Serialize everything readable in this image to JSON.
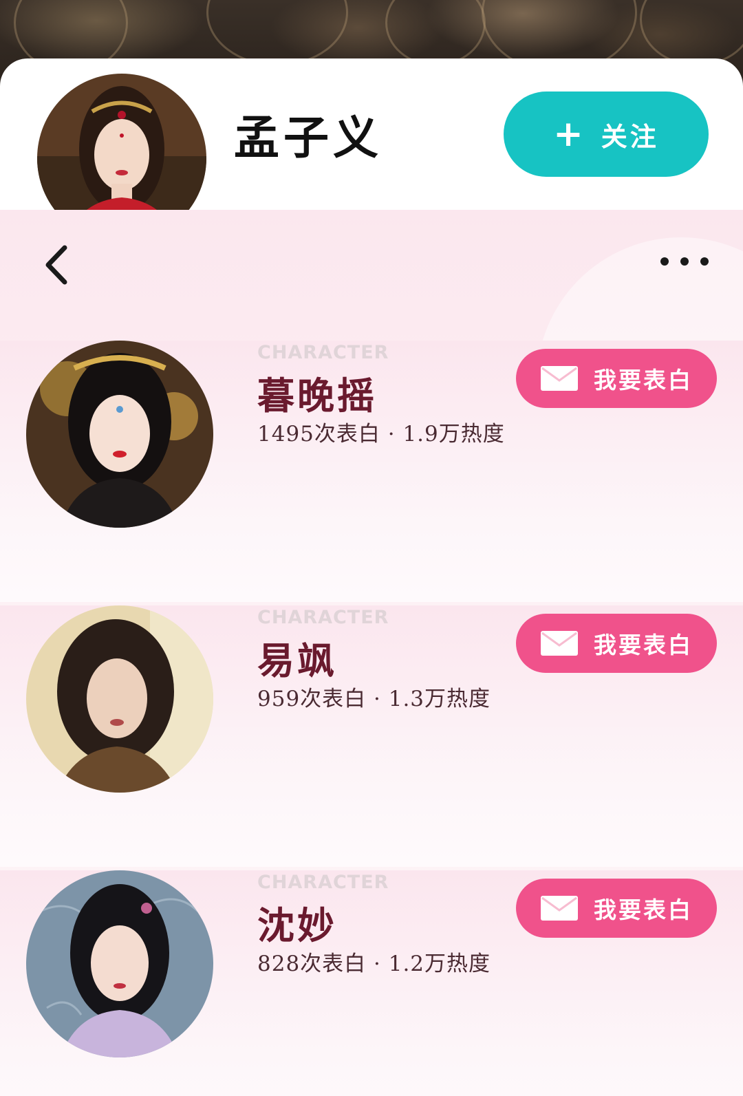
{
  "profile": {
    "name": "孟子义",
    "follow_label": "关注",
    "follow_icon": "plus-icon"
  },
  "nav": {
    "back_icon": "chevron-left-icon",
    "more_icon": "more-dots-icon"
  },
  "characters": [
    {
      "tag": "CHARACTER",
      "name": "暮晚摇",
      "stats": "1495次表白 · 1.9万热度",
      "button_label": "我要表白",
      "button_icon": "mail-icon"
    },
    {
      "tag": "CHARACTER",
      "name": "易飒",
      "stats": "959次表白 · 1.3万热度",
      "button_label": "我要表白",
      "button_icon": "mail-icon"
    },
    {
      "tag": "CHARACTER",
      "name": "沈妙",
      "stats": "828次表白 · 1.2万热度",
      "button_label": "我要表白",
      "button_icon": "mail-icon"
    }
  ],
  "colors": {
    "follow_button": "#17c3c3",
    "confess_button": "#f0528b",
    "character_name": "#6a1a2e",
    "background_pink": "#fbe7ee"
  }
}
